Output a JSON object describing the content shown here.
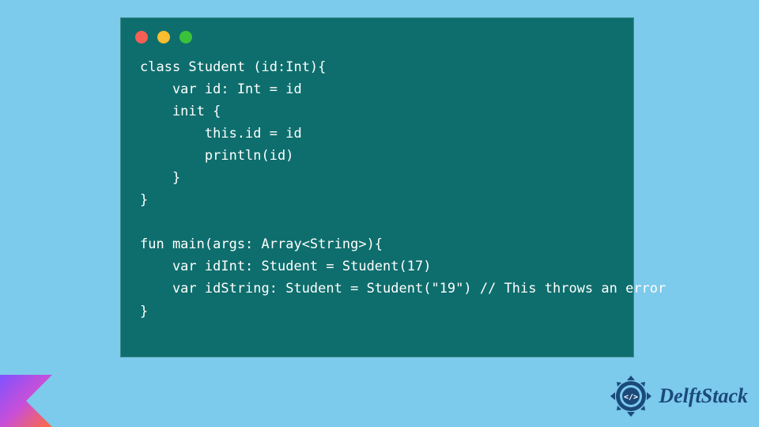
{
  "code": {
    "lines": [
      "class Student (id:Int){",
      "    var id: Int = id",
      "    init {",
      "        this.id = id",
      "        println(id)",
      "    }",
      "}",
      "",
      "fun main(args: Array<String>){",
      "    var idInt: Student = Student(17)",
      "    var idString: Student = Student(\"19\") // This throws an error",
      "}"
    ]
  },
  "brand": {
    "name": "DelftStack"
  },
  "window": {
    "dot_red": "#f65f56",
    "dot_yellow": "#fabd2f",
    "dot_green": "#3ac33a"
  },
  "colors": {
    "page_bg": "#7ccaec",
    "card_bg": "#0e6e6d",
    "code_fg": "#ffffff",
    "brand_fg": "#1b4a7a"
  }
}
